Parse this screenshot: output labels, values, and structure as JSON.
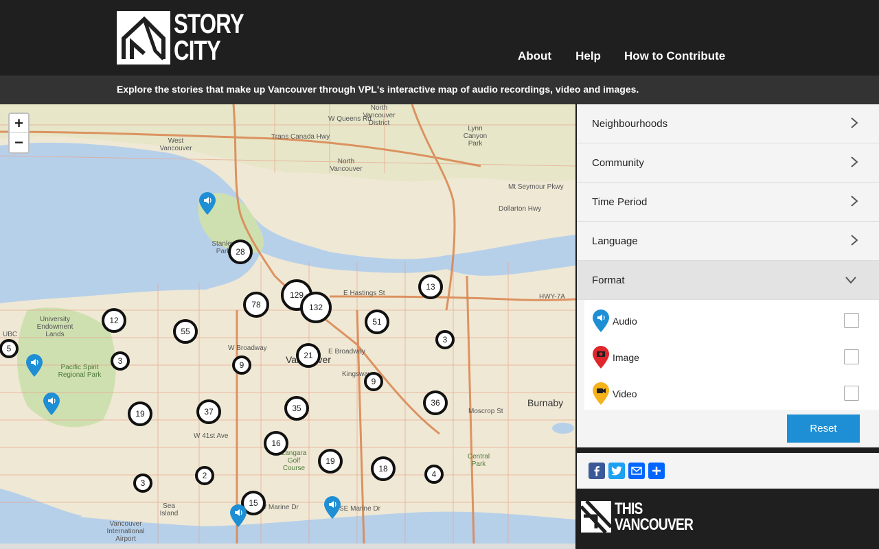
{
  "header": {
    "logo_line1": "STORY",
    "logo_line2": "CITY",
    "nav": [
      "About",
      "Help",
      "How to Contribute"
    ],
    "tagline": "Explore the stories that make up Vancouver through VPL's interactive map of audio recordings, video and images."
  },
  "map": {
    "zoom_in": "+",
    "zoom_out": "−",
    "labels": {
      "north_vancouver_district": "North Vancouver District",
      "west_vancouver": "West Vancouver",
      "north_vancouver": "North Vancouver",
      "lynn_canyon_park": "Lynn Canyon Park",
      "ubc": "UBC",
      "university_endowment_lands": "University Endowment Lands",
      "pacific_spirit": "Pacific Spirit Regional Park",
      "vancouver": "Vancouver",
      "burnaby": "Burnaby",
      "sea_island": "Sea Island",
      "airport": "Vancouver International Airport",
      "langara": "Langara Golf Course",
      "central_park": "Central Park",
      "stanley_park": "Stanley Park",
      "w_queens_rd": "W Queens Rd",
      "trans_canada": "Trans Canada Hwy",
      "hastings": "E Hastings St",
      "hwy1a": "HWY-7A",
      "w_broadway": "W Broadway",
      "e_broadway": "E Broadway",
      "kingsway": "Kingsway",
      "w_41st": "W 41st Ave",
      "se_marine": "SE Marine Dr",
      "sw_marine": "SW Marine Dr",
      "moscrop": "Moscrop St",
      "dollarton": "Dollarton Hwy",
      "mt_seymour": "Mt Seymour Pkwy"
    },
    "clusters": [
      "28",
      "13",
      "129",
      "132",
      "78",
      "12",
      "55",
      "51",
      "3",
      "5",
      "3",
      "9",
      "21",
      "9",
      "36",
      "19",
      "37",
      "35",
      "16",
      "19",
      "18",
      "4",
      "3",
      "2",
      "15"
    ],
    "pin_icon": "speaker-icon",
    "pin_color": "#1e8fd4"
  },
  "filters": {
    "items": [
      "Neighbourhoods",
      "Community",
      "Time Period",
      "Language",
      "Format"
    ],
    "format_options": [
      {
        "label": "Audio",
        "color": "#1e8fd4",
        "icon": "speaker-icon"
      },
      {
        "label": "Image",
        "color": "#e0252c",
        "icon": "camera-icon"
      },
      {
        "label": "Video",
        "color": "#f5b21b",
        "icon": "video-camera-icon"
      }
    ],
    "reset_label": "Reset"
  },
  "share": {
    "buttons": [
      "facebook",
      "twitter",
      "email",
      "share"
    ]
  },
  "footer": {
    "logo_line1": "THIS",
    "logo_line2": "VANCOUVER"
  }
}
